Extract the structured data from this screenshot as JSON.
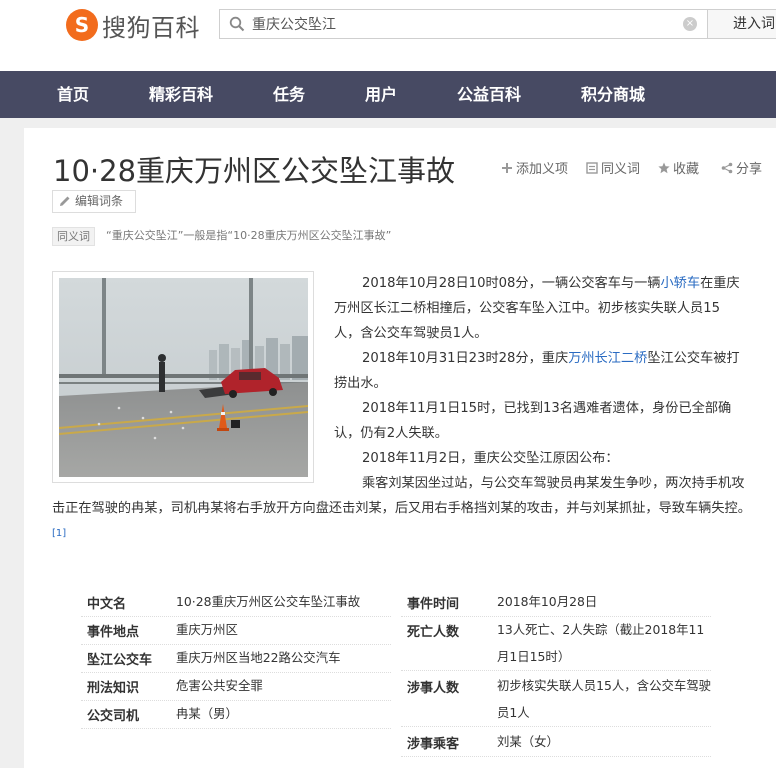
{
  "header": {
    "logo_mark": "S",
    "logo_text": "搜狗百科",
    "search_value": "重庆公交坠江",
    "clear_symbol": "×",
    "enter_label": "进入词"
  },
  "nav": [
    "首页",
    "精彩百科",
    "任务",
    "用户",
    "公益百科",
    "积分商城"
  ],
  "article": {
    "title": "10·28重庆万州区公交坠江事故",
    "actions": {
      "add_synonym": "添加义项",
      "synonym_entry": "同义词",
      "favorite": "收藏",
      "share": "分享"
    },
    "edit_label": "编辑词条",
    "synonym_tag": "同义词",
    "synonym_text": "“重庆公交坠江”一般是指“10·28重庆万州区公交坠江事故”",
    "paragraphs": {
      "p1_a": "2018年10月28日10时08分，一辆公交客车与一辆",
      "p1_link": "小轿车",
      "p1_b": "在重庆万州区长江二桥相撞后，公交客车坠入江中。初步核实失联人员15人，含公交车驾驶员1人。",
      "p2_a": "2018年10月31日23时28分，重庆",
      "p2_link": "万州长江二桥",
      "p2_b": "坠江公交车被打捞出水。",
      "p3": "2018年11月1日15时，已找到13名遇难者遗体，身份已全部确认，仍有2人失联。",
      "p4": "2018年11月2日，重庆公交坠江原因公布：",
      "p5": "乘客刘某因坐过站，与公交车驾驶员冉某发生争吵，两次持手机攻击正在驾驶的冉某，司机冉某将右手放开方向盘还击刘某，后又用右手格挡刘某的攻击，并与刘某抓扯，导致车辆失控。",
      "ref": "[1]"
    }
  },
  "infobox": {
    "left": [
      {
        "label": "中文名",
        "value": "10·28重庆万州区公交车坠江事故"
      },
      {
        "label": "事件地点",
        "value": "重庆万州区"
      },
      {
        "label": "坠江公交车",
        "value": "重庆万州区当地22路公交汽车"
      },
      {
        "label": "刑法知识",
        "value": "危害公共安全罪"
      },
      {
        "label": "公交司机",
        "value": "冉某（男）"
      }
    ],
    "right": [
      {
        "label": "事件时间",
        "value": "2018年10月28日"
      },
      {
        "label": "死亡人数",
        "value": "13人死亡、2人失踪（截止2018年11月1日15时）"
      },
      {
        "label": "涉事人数",
        "value": "初步核实失联人员15人，含公交车驾驶员1人"
      },
      {
        "label": "涉事乘客",
        "value": "刘某（女）"
      }
    ]
  },
  "colors": {
    "nav_bg": "#474a63",
    "logo": "#f26c1d",
    "link": "#2a6bc2"
  }
}
